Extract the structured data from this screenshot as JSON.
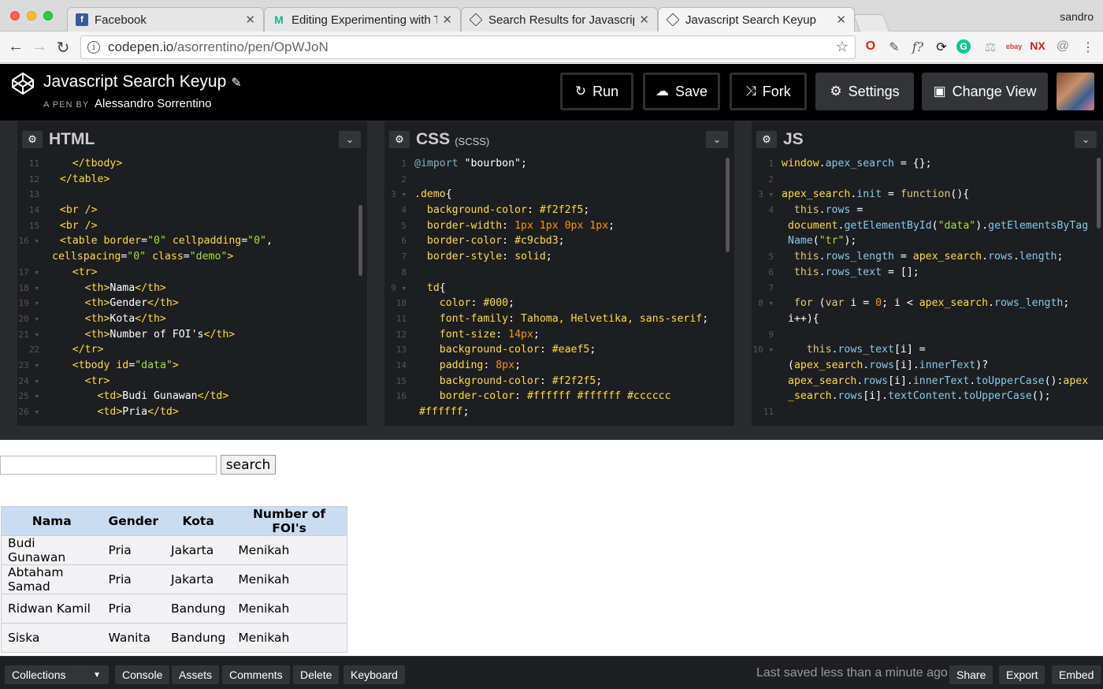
{
  "browser": {
    "user": "sandro",
    "tabs": [
      {
        "title": "Facebook",
        "icon": "facebook-icon"
      },
      {
        "title": "Editing Experimenting with Tab",
        "icon": "medium-icon"
      },
      {
        "title": "Search Results for Javascript s",
        "icon": "codepen-icon"
      },
      {
        "title": "Javascript Search Keyup",
        "icon": "codepen-icon"
      }
    ],
    "url_host": "codepen.io",
    "url_path": "/asorrentino/pen/OpWJoN"
  },
  "pen": {
    "title": "Javascript Search Keyup",
    "by_label": "A PEN BY",
    "author": "Alessandro Sorrentino",
    "buttons": {
      "run": "Run",
      "save": "Save",
      "fork": "Fork",
      "settings": "Settings",
      "change_view": "Change View"
    }
  },
  "editors": {
    "html": {
      "name": "HTML",
      "sub": ""
    },
    "css": {
      "name": "CSS",
      "sub": "(SCSS)"
    },
    "js": {
      "name": "JS",
      "sub": ""
    }
  },
  "result": {
    "search_value": "",
    "search_button": "search",
    "table": {
      "headers": [
        "Nama",
        "Gender",
        "Kota",
        "Number of FOI's"
      ],
      "rows": [
        [
          "Budi Gunawan",
          "Pria",
          "Jakarta",
          "Menikah"
        ],
        [
          "Abtaham Samad",
          "Pria",
          "Jakarta",
          "Menikah"
        ],
        [
          "Ridwan Kamil",
          "Pria",
          "Bandung",
          "Menikah"
        ],
        [
          "Siska",
          "Wanita",
          "Bandung",
          "Menikah"
        ]
      ]
    }
  },
  "footer": {
    "collections": "Collections",
    "console": "Console",
    "assets": "Assets",
    "comments": "Comments",
    "delete": "Delete",
    "keyboard": "Keyboard",
    "status": "Last saved less than a minute ago",
    "share": "Share",
    "export": "Export",
    "embed": "Embed"
  }
}
